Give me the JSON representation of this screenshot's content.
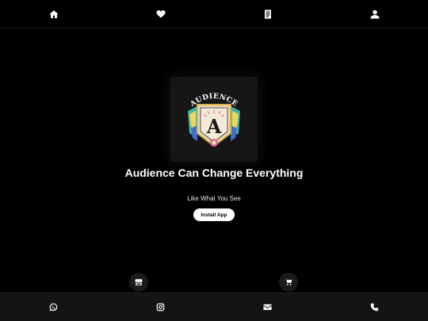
{
  "top_nav": {
    "items": [
      {
        "icon": "home-icon"
      },
      {
        "icon": "heart-icon"
      },
      {
        "icon": "document-icon"
      },
      {
        "icon": "user-icon"
      }
    ]
  },
  "logo": {
    "text": "AUDIENCE",
    "letter": "A",
    "colors": {
      "gold": "#d9b34a",
      "teal": "#3fb6a8",
      "pink": "#e36a8a",
      "yellow": "#f1d65a",
      "blue": "#3b6fd1"
    }
  },
  "hero": {
    "title": "Audience Can Change Everything",
    "subtitle": "Like What You See",
    "install_label": "Install App"
  },
  "floating": {
    "left_icon": "store-icon",
    "right_icon": "cart-icon"
  },
  "bottom_bar": {
    "items": [
      {
        "icon": "whatsapp-icon"
      },
      {
        "icon": "instagram-icon"
      },
      {
        "icon": "envelope-icon"
      },
      {
        "icon": "phone-icon"
      }
    ]
  }
}
